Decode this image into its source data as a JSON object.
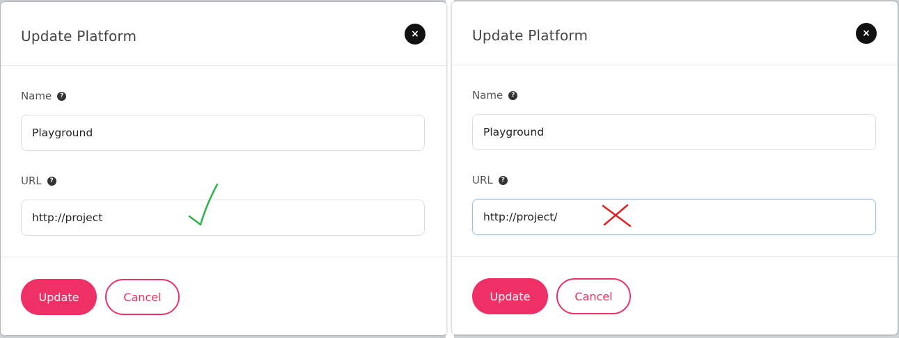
{
  "panels": [
    {
      "title": "Update Platform",
      "close_icon": "×",
      "name_label": "Name",
      "name_value": "Playground",
      "url_label": "URL",
      "url_value": "http://project",
      "help_icon": "?",
      "update_label": "Update",
      "cancel_label": "Cancel",
      "annotation": "check-mark",
      "annotation_color": "#2fb04a"
    },
    {
      "title": "Update Platform",
      "close_icon": "×",
      "name_label": "Name",
      "name_value": "Playground",
      "url_label": "URL",
      "url_value": "http://project/",
      "help_icon": "?",
      "update_label": "Update",
      "cancel_label": "Cancel",
      "annotation": "cross-mark",
      "annotation_color": "#e02020"
    }
  ],
  "colors": {
    "accent": "#ee3066",
    "close_bg": "#111111"
  }
}
